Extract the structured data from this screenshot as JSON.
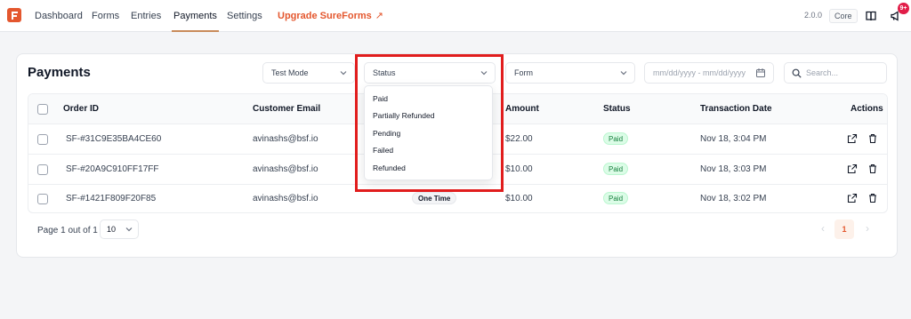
{
  "nav": {
    "items": [
      "Dashboard",
      "Forms",
      "Entries",
      "Payments",
      "Settings"
    ],
    "active": "Payments",
    "upgrade_label": "Upgrade SureForms",
    "upgrade_arrow": "↗",
    "version": "2.0.0",
    "tier": "Core",
    "notification_count": "9+"
  },
  "page": {
    "title": "Payments",
    "filters": {
      "mode": "Test Mode",
      "status": "Status",
      "form": "Form",
      "date_placeholder": "mm/dd/yyyy - mm/dd/yyyy",
      "search_placeholder": "Search..."
    },
    "status_options": [
      "Paid",
      "Partially Refunded",
      "Pending",
      "Failed",
      "Refunded"
    ]
  },
  "table": {
    "headers": [
      "Order ID",
      "Customer Email",
      "Amount",
      "Status",
      "Transaction Date",
      "Actions"
    ],
    "rows": [
      {
        "order_id": "SF-#31C9E35BA4CE60",
        "email": "avinashs@bsf.io",
        "type": "",
        "amount": "$22.00",
        "status": "Paid",
        "date": "Nov 18, 3:04 PM"
      },
      {
        "order_id": "SF-#20A9C910FF17FF",
        "email": "avinashs@bsf.io",
        "type": "",
        "amount": "$10.00",
        "status": "Paid",
        "date": "Nov 18, 3:03 PM"
      },
      {
        "order_id": "SF-#1421F809F20F85",
        "email": "avinashs@bsf.io",
        "type": "One Time",
        "amount": "$10.00",
        "status": "Paid",
        "date": "Nov 18, 3:02 PM"
      }
    ]
  },
  "pagination": {
    "info": "Page 1 out of 1",
    "per_page": "10",
    "current_page": "1"
  },
  "colors": {
    "brand": "#e4572e",
    "paid": "#15803d",
    "highlight": "#e11d1d"
  }
}
